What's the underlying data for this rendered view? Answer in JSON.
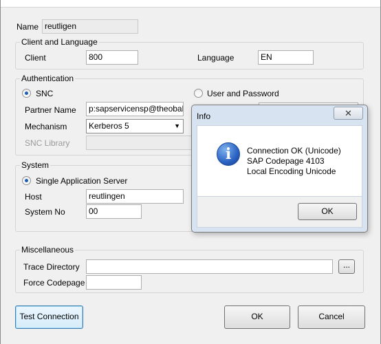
{
  "general": {
    "name_label": "Name",
    "name_value": "reutligen"
  },
  "client_language": {
    "title": "Client and Language",
    "client_label": "Client",
    "client_value": "800",
    "language_label": "Language",
    "language_value": "EN"
  },
  "authentication": {
    "title": "Authentication",
    "snc_label": "SNC",
    "snc_selected": true,
    "user_password_label": "User and Password",
    "partner_name_label": "Partner Name",
    "partner_name_value": "p:sapservicensp@theobald",
    "mechanism_label": "Mechanism",
    "mechanism_value": "Kerberos 5",
    "snc_library_label": "SNC Library",
    "snc_library_value": ""
  },
  "system": {
    "title": "System",
    "single_server_label": "Single Application Server",
    "single_server_selected": true,
    "host_label": "Host",
    "host_value": "reutlingen",
    "system_no_label": "System No",
    "system_no_value": "00"
  },
  "miscellaneous": {
    "title": "Miscellaneous",
    "trace_dir_label": "Trace Directory",
    "trace_dir_value": "",
    "browse_label": "...",
    "force_codepage_label": "Force Codepage",
    "force_codepage_value": ""
  },
  "buttons": {
    "test_connection": "Test Connection",
    "ok": "OK",
    "cancel": "Cancel"
  },
  "dialog": {
    "title": "Info",
    "close_glyph": "✕",
    "icon": "info-icon",
    "lines": [
      "Connection OK (Unicode)",
      "SAP Codepage 4103",
      "Local Encoding Unicode"
    ],
    "ok_label": "OK"
  },
  "colors": {
    "window_bg": "#f0f0f0",
    "dialog_frame": "#d7e3f0",
    "radio_dot": "#1e5fb4"
  }
}
